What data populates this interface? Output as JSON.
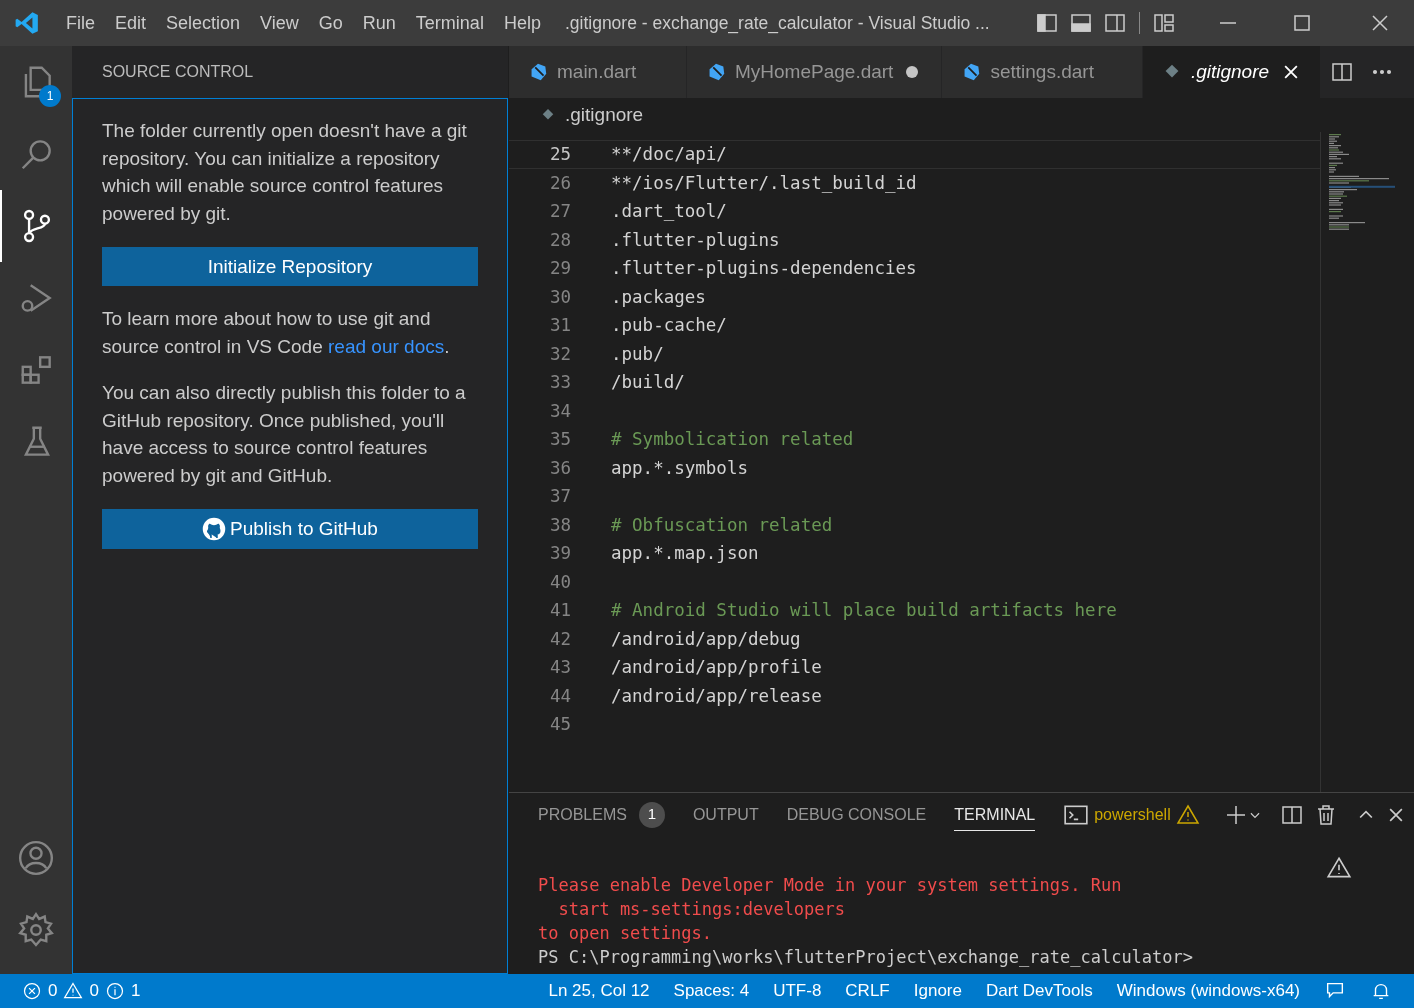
{
  "menu": [
    "File",
    "Edit",
    "Selection",
    "View",
    "Go",
    "Run",
    "Terminal",
    "Help"
  ],
  "window": {
    "title": ".gitignore - exchange_rate_calculator - Visual Studio ..."
  },
  "activity_bar": [
    {
      "kind": "files",
      "selected": false,
      "badge": "1"
    },
    {
      "kind": "search",
      "selected": false
    },
    {
      "kind": "scm",
      "selected": true
    },
    {
      "kind": "debug",
      "selected": false
    },
    {
      "kind": "extensions",
      "selected": false
    },
    {
      "kind": "testing",
      "selected": false
    }
  ],
  "activity_bar_bottom": [
    {
      "kind": "account"
    },
    {
      "kind": "settings"
    }
  ],
  "sidebar": {
    "title": "SOURCE CONTROL",
    "paragraph_1": "The folder currently open doesn't have a git repository. You can initialize a repository which will enable source control features powered by git.",
    "init_button": "Initialize Repository",
    "paragraph_2": {
      "before": "To learn more about how to use git and source control in VS Code ",
      "link": "read our docs",
      "after": "."
    },
    "paragraph_3": "You can also directly publish this folder to a GitHub repository. Once published, you'll have access to source control features powered by git and GitHub.",
    "publish_button": "Publish to GitHub"
  },
  "tabs": [
    {
      "label": "main.dart",
      "kind": "dart",
      "selected": false,
      "modified": false,
      "preview": false
    },
    {
      "label": "MyHomePage.dart",
      "kind": "dart",
      "selected": false,
      "modified": true,
      "preview": false
    },
    {
      "label": "settings.dart",
      "kind": "dart",
      "selected": false,
      "modified": false,
      "preview": false
    },
    {
      "label": ".gitignore",
      "kind": "file",
      "selected": true,
      "modified": false,
      "preview": true
    }
  ],
  "breadcrumb": ".gitignore",
  "editor": {
    "lines": [
      {
        "number": "25",
        "text": "**/doc/api/",
        "kind": "code",
        "current": true
      },
      {
        "number": "26",
        "text": "**/ios/Flutter/.last_build_id",
        "kind": "code",
        "current": false
      },
      {
        "number": "27",
        "text": ".dart_tool/",
        "kind": "code",
        "current": false
      },
      {
        "number": "28",
        "text": ".flutter-plugins",
        "kind": "code",
        "current": false
      },
      {
        "number": "29",
        "text": ".flutter-plugins-dependencies",
        "kind": "code",
        "current": false
      },
      {
        "number": "30",
        "text": ".packages",
        "kind": "code",
        "current": false
      },
      {
        "number": "31",
        "text": ".pub-cache/",
        "kind": "code",
        "current": false
      },
      {
        "number": "32",
        "text": ".pub/",
        "kind": "code",
        "current": false
      },
      {
        "number": "33",
        "text": "/build/",
        "kind": "code",
        "current": false
      },
      {
        "number": "34",
        "kind": "blank",
        "current": false
      },
      {
        "number": "35",
        "text": "# Symbolication related",
        "kind": "comment",
        "current": false
      },
      {
        "number": "36",
        "text": "app.*.symbols",
        "kind": "code",
        "current": false
      },
      {
        "number": "37",
        "kind": "blank",
        "current": false
      },
      {
        "number": "38",
        "text": "# Obfuscation related",
        "kind": "comment",
        "current": false
      },
      {
        "number": "39",
        "text": "app.*.map.json",
        "kind": "code",
        "current": false
      },
      {
        "number": "40",
        "kind": "blank",
        "current": false
      },
      {
        "number": "41",
        "text": "# Android Studio will place build artifacts here",
        "kind": "comment",
        "current": false
      },
      {
        "number": "42",
        "text": "/android/app/debug",
        "kind": "code",
        "current": false
      },
      {
        "number": "43",
        "text": "/android/app/profile",
        "kind": "code",
        "current": false
      },
      {
        "number": "44",
        "text": "/android/app/release",
        "kind": "code",
        "current": false
      },
      {
        "number": "45",
        "kind": "blank",
        "current": false
      }
    ]
  },
  "panel": {
    "tabs": [
      {
        "label": "PROBLEMS",
        "badge": "1",
        "selected": false
      },
      {
        "label": "OUTPUT",
        "selected": false
      },
      {
        "label": "DEBUG CONSOLE",
        "selected": false
      },
      {
        "label": "TERMINAL",
        "selected": true
      }
    ],
    "shell": "powershell",
    "terminal": [
      {
        "text": "Please enable Developer Mode in your system settings. Run",
        "kind": "error"
      },
      {
        "text": "  start ms-settings:developers",
        "kind": "error"
      },
      {
        "text": "to open settings.",
        "kind": "error"
      },
      {
        "text": "PS C:\\Programming\\works\\flutterProject\\exchange_rate_calculator>",
        "kind": "normal"
      }
    ]
  },
  "status_bar": {
    "errors": "0",
    "warnings": "0",
    "infos": "1",
    "items": [
      "Ln 25, Col 12",
      "Spaces: 4",
      "UTF-8",
      "CRLF",
      "Ignore",
      "Dart DevTools",
      "Windows (windows-x64)"
    ]
  }
}
